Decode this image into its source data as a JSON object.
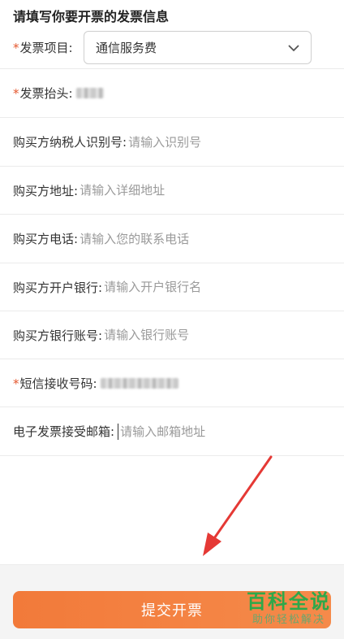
{
  "form": {
    "title": "请填写你要开票的发票信息",
    "required_mark": "*",
    "invoice_item": {
      "label": "发票项目:",
      "value": "通信服务费"
    },
    "invoice_header": {
      "label": "发票抬头:"
    },
    "taxpayer_id": {
      "label": "购买方纳税人识别号:",
      "placeholder": "请输入识别号"
    },
    "address": {
      "label": "购买方地址:",
      "placeholder": "请输入详细地址"
    },
    "phone": {
      "label": "购买方电话:",
      "placeholder": "请输入您的联系电话"
    },
    "bank": {
      "label": "购买方开户银行:",
      "placeholder": "请输入开户银行名"
    },
    "bank_account": {
      "label": "购买方银行账号:",
      "placeholder": "请输入银行账号"
    },
    "sms_phone": {
      "label": "短信接收号码:"
    },
    "email": {
      "label": "电子发票接受邮箱:",
      "placeholder": "请输入邮箱地址"
    }
  },
  "submit_label": "提交开票",
  "watermark": {
    "title": "百科全说",
    "subtitle": "助你轻松解决"
  },
  "colors": {
    "accent": "#f27a3a",
    "required": "#e4572e",
    "watermark": "#2ea84a"
  }
}
